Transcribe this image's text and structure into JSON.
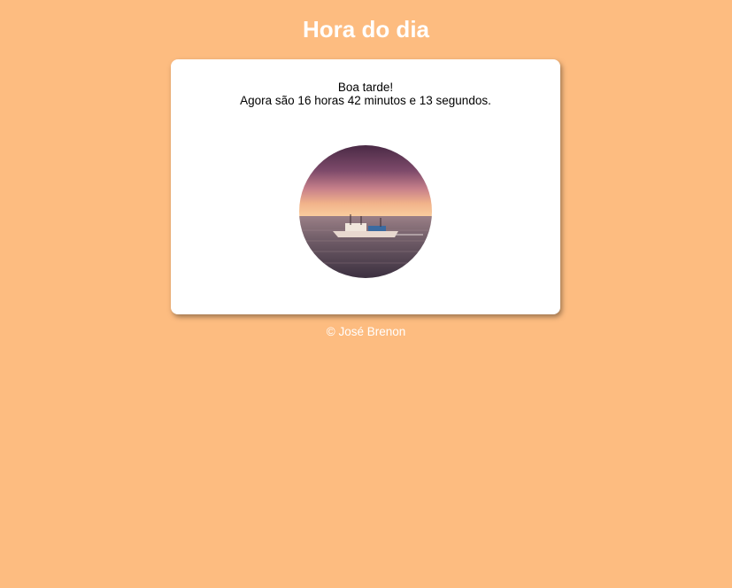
{
  "header": {
    "title": "Hora do dia"
  },
  "card": {
    "greeting": "Boa tarde!",
    "time_message": "Agora são 16 horas 42 minutos e 13 segundos.",
    "image_alt": "boat-at-sunset-photo"
  },
  "footer": {
    "text": "© José Brenon"
  },
  "colors": {
    "background": "#fdbc80",
    "card": "#ffffff",
    "title": "#ffffff"
  }
}
